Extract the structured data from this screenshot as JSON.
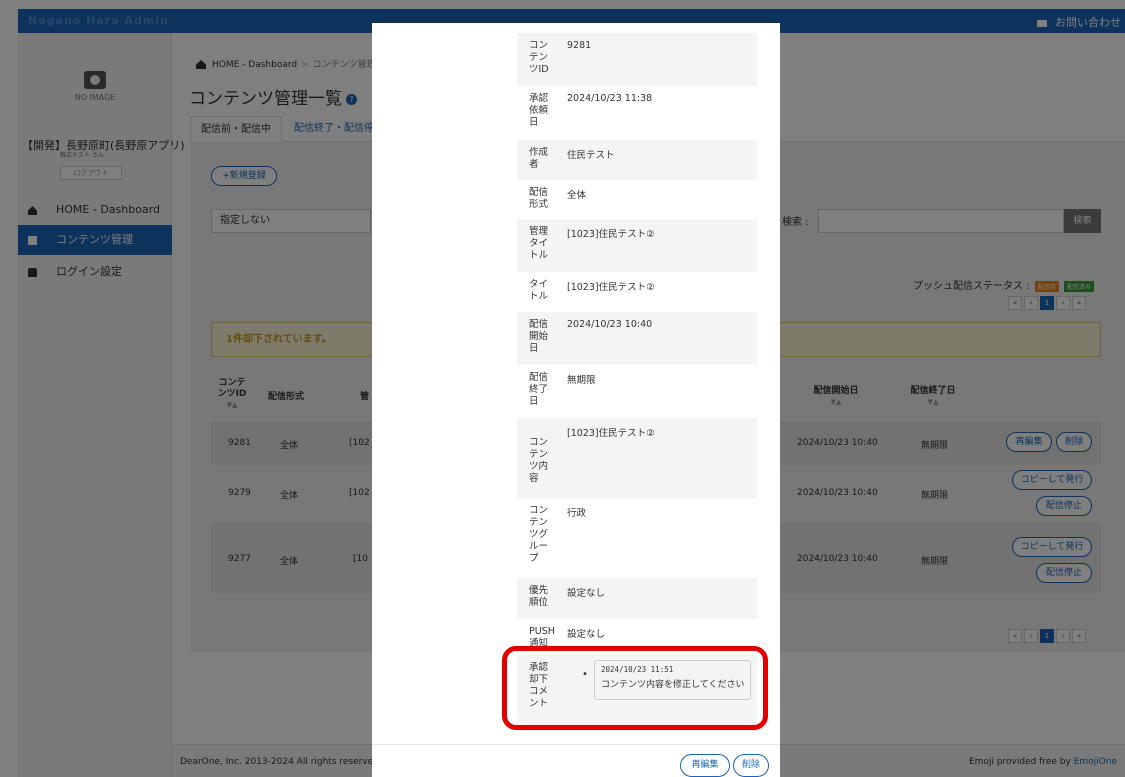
{
  "topbar": {
    "brand": "Nagano Hara Admin",
    "contact": "お問い合わせ"
  },
  "sidebar": {
    "avatar_text": "NO IMAGE",
    "account_name": "【開発】長野原町(長野原アプリ)",
    "account_sub": "株式テスト さん",
    "logout": "ログアウト",
    "items": [
      {
        "label": "HOME - Dashboard",
        "icon": "home-icon"
      },
      {
        "label": "コンテンツ管理",
        "icon": "document-icon"
      },
      {
        "label": "ログイン設定",
        "icon": "lock-icon"
      }
    ]
  },
  "breadcrumb": {
    "home": "HOME - Dashboard",
    "sep": ">",
    "current": "コンテンツ管理 >"
  },
  "page": {
    "title": "コンテンツ管理一覧",
    "help": "?"
  },
  "tabs": {
    "active": "配信前・配信中",
    "inactive": "配信終了・配信停止"
  },
  "toolbar": {
    "new": "+新規登録",
    "filter": "指定しない",
    "search_label": "検索 :",
    "search_button": "検索"
  },
  "push_status": {
    "label": "プッシュ配信ステータス :",
    "badge_waiting": "配信待",
    "badge_done": "配信済み"
  },
  "pager": [
    "«",
    "‹",
    "1",
    "›",
    "»"
  ],
  "alert": "1件却下されています。",
  "table": {
    "headers": {
      "id": "コンテンツID",
      "format": "配信形式",
      "title": "管",
      "start": "配信開始日",
      "end": "配信終了日",
      "sort": "▼▲"
    },
    "rows": [
      {
        "id": "9281",
        "format": "全体",
        "title": "[102",
        "start": "2024/10/23 10:40",
        "end": "無期限"
      },
      {
        "id": "9279",
        "format": "全体",
        "title": "[102",
        "start": "2024/10/23 10:40",
        "end": "無期限"
      },
      {
        "id": "9277",
        "format": "全体",
        "title": "[10",
        "start": "2024/10/23 10:40",
        "end": "無期限"
      }
    ],
    "actions": {
      "edit": "再編集",
      "delete": "削除",
      "copy": "コピーして発行",
      "stop": "配信停止"
    }
  },
  "footer": {
    "left": "DearOne, Inc. 2013-2024  All rights reserved.",
    "right": "Emoji provided free by ",
    "link": "EmojiOne"
  },
  "modal": {
    "details": [
      {
        "label": "コンテンツID",
        "value": "9281"
      },
      {
        "label": "承認依頼日",
        "value": "2024/10/23 11:38"
      },
      {
        "label": "作成者",
        "value": "住民テスト"
      },
      {
        "label": "配信形式",
        "value": "全体"
      },
      {
        "label": "管理タイトル",
        "value": "[1023]住民テスト②"
      },
      {
        "label": "タイトル",
        "value": "[1023]住民テスト②"
      },
      {
        "label": "配信開始日",
        "value": "2024/10/23 10:40"
      },
      {
        "label": "配信終了日",
        "value": "無期限"
      },
      {
        "label": "コンテンツ内容",
        "value": "[1023]住民テスト②"
      },
      {
        "label": "コンテンツグループ",
        "value": "行政"
      },
      {
        "label": "優先順位",
        "value": "設定なし"
      },
      {
        "label": "PUSH通知",
        "value": "設定なし"
      },
      {
        "label": "承認却下コメント",
        "value": ""
      }
    ],
    "comment": {
      "bullet": "•",
      "time": "2024/10/23 11:51",
      "text": "コンテンツ内容を修正してください"
    },
    "buttons": {
      "edit": "再編集",
      "delete": "削除"
    },
    "highlight_color": "#e00000"
  }
}
